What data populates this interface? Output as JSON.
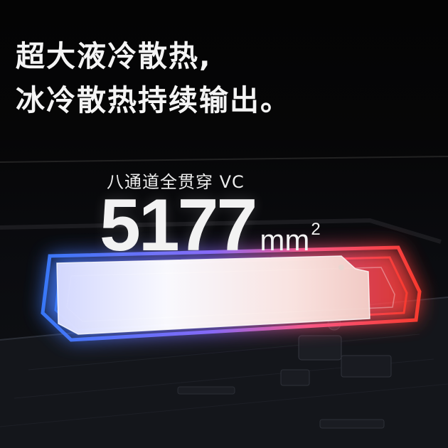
{
  "headline": {
    "line1": "超大液冷散热,",
    "line2": "冰冷散热持续输出。"
  },
  "vc_label": "八通道全贯穿 VC",
  "area": {
    "value": "5177",
    "unit": "mm",
    "exponent": "2"
  },
  "colors": {
    "cool_glow": "#2f6bff",
    "warm_glow": "#ff4a3c",
    "plate": "#f3ece6",
    "text": "#f4f4f4"
  }
}
